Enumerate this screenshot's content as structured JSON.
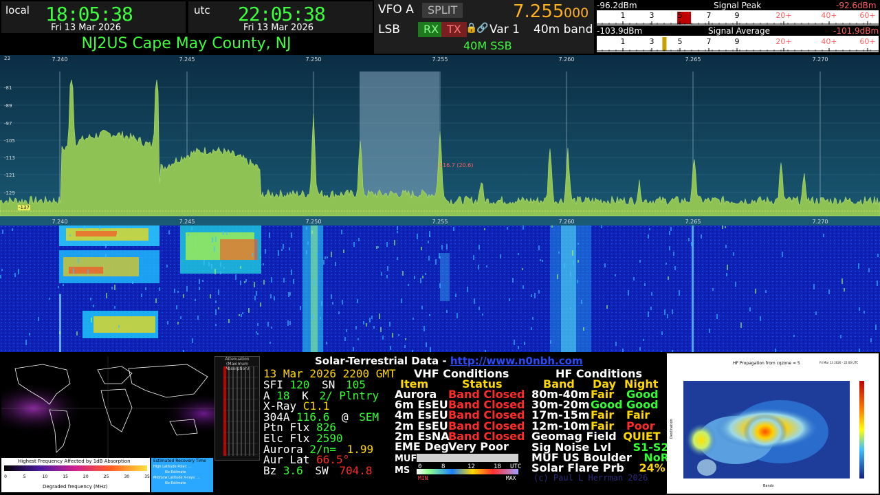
{
  "clocks": {
    "local": {
      "label": "local",
      "time": "18:05:38",
      "date": "Fri 13 Mar 2026"
    },
    "utc": {
      "label": "utc",
      "time": "22:05:38",
      "date": "Fri 13 Mar 2026"
    }
  },
  "station": "NJ2US Cape May County, NJ",
  "vfo": {
    "name": "VFO A",
    "split_label": "SPLIT",
    "mode": "LSB",
    "rx_label": "RX",
    "tx_label": "TX",
    "var_label": "Var 1",
    "freq_main": "7.255",
    "freq_sub": "000",
    "band": "40m band",
    "band_mode": "40M SSB"
  },
  "meters": {
    "peak": {
      "dbm": "-96.2dBm",
      "title": "Signal Peak",
      "right_dbm": "-92.6dBm",
      "level": 0.31
    },
    "avg": {
      "dbm": "-103.9dBm",
      "title": "Signal Average",
      "right_dbm": "-101.9dBm",
      "level": 0.24
    },
    "scale": [
      "1",
      "3",
      "5",
      "7",
      "9",
      "20+",
      "40+",
      "60+"
    ]
  },
  "spectrum": {
    "freq_labels": [
      "7.240",
      "7.245",
      "7.250",
      "7.255",
      "7.260",
      "7.265",
      "7.270"
    ],
    "db_labels": [
      "23",
      "-81",
      "-89",
      "-97",
      "-105",
      "-113",
      "-121",
      "-129"
    ],
    "cursor_readout": "-116.7 (20.6)",
    "floor_label": "-137"
  },
  "absorption": {
    "legend_title": "Highest Frequency Affected by 1dB Absorption",
    "legend_axis": "Degraded frequency (MHz)",
    "legend_ticks": [
      "0",
      "5",
      "10",
      "15",
      "20",
      "25",
      "30",
      "35"
    ],
    "recovery_title": "Estimated Recovery Time",
    "recovery_lines": [
      "High Latitude Polar: ...",
      "No Estimate",
      "Mid/Low Latitude X-rays: ...",
      "No Estimate"
    ],
    "atten_title": "Attenuation (Maximum Absorption)"
  },
  "solar": {
    "title": "Solar-Terrestrial Data -",
    "url": "http://www.n0nbh.com",
    "date": "13 Mar 2026 2200 GMT",
    "left": [
      {
        "k": "SFI",
        "v": "120",
        "k2": "SN",
        "v2": "105"
      },
      {
        "k": "A",
        "v": "18",
        "k2": "K",
        "v2": "2/ Plntry"
      },
      {
        "k": "X-Ray",
        "v": "C1.1"
      },
      {
        "k": "304A",
        "v": "116.6",
        "k2": "@",
        "v2": "SEM"
      },
      {
        "k": "Ptn Flx",
        "v": "826"
      },
      {
        "k": "Elc Flx",
        "v": "2590"
      },
      {
        "k": "Aurora",
        "v": "2/n=",
        "v2": "1.99"
      },
      {
        "k": "Aur Lat",
        "v": "66.5°"
      },
      {
        "k": "Bz",
        "v": "3.6",
        "k2": "SW",
        "v2": "704.8"
      }
    ],
    "vhf_title": "VHF Conditions",
    "vhf_cols": [
      "Item",
      "Status"
    ],
    "vhf": [
      {
        "item": "Aurora",
        "status": "Band Closed"
      },
      {
        "item": "6m EsEU",
        "status": "Band Closed"
      },
      {
        "item": "4m EsEU",
        "status": "Band Closed"
      },
      {
        "item": "2m EsEU",
        "status": "Band Closed"
      },
      {
        "item": "2m EsNA",
        "status": "Band Closed"
      },
      {
        "item": "EME Deg",
        "status": "Very Poor"
      }
    ],
    "muf_label": "MUF",
    "ms_label": "MS",
    "muf_ticks": [
      "0",
      "8",
      "12",
      "18",
      "UTC"
    ],
    "muf_ends": [
      "MIN",
      "MAX"
    ],
    "hf_title": "HF Conditions",
    "hf_cols": [
      "Band",
      "Day",
      "Night"
    ],
    "hf": [
      {
        "band": "80m-40m",
        "day": "Fair",
        "night": "Good"
      },
      {
        "band": "30m-20m",
        "day": "Good",
        "night": "Good"
      },
      {
        "band": "17m-15m",
        "day": "Fair",
        "night": "Fair"
      },
      {
        "band": "12m-10m",
        "day": "Fair",
        "night": "Poor"
      }
    ],
    "geomag_label": "Geomag Field",
    "geomag": "QUIET",
    "noise_label": "Sig Noise Lvl",
    "noise": "S1-S2",
    "muf_b_label": "MUF US Boulder",
    "muf_b": "NoRpt",
    "flare_label": "Solar Flare Prb",
    "flare": "24%",
    "footer": "(c) Paul L Herrman 2026"
  },
  "propagation": {
    "title": "HF Propagation from cqzone = 5",
    "stamp": "Fri Mar 13 2026 - 22:00 UTC",
    "xlabel": "Bands",
    "ylabel": "Destination"
  },
  "colors": {
    "clock_green": "#3dff3d",
    "freq_orange": "#ffb020",
    "spectrum_bg": "#0e3a55",
    "spectrum_fill": "#8fc254",
    "waterfall_bg": "#0c1da8",
    "good": "#30ff30",
    "fair": "#ffd800",
    "poor": "#ff2a2a"
  }
}
